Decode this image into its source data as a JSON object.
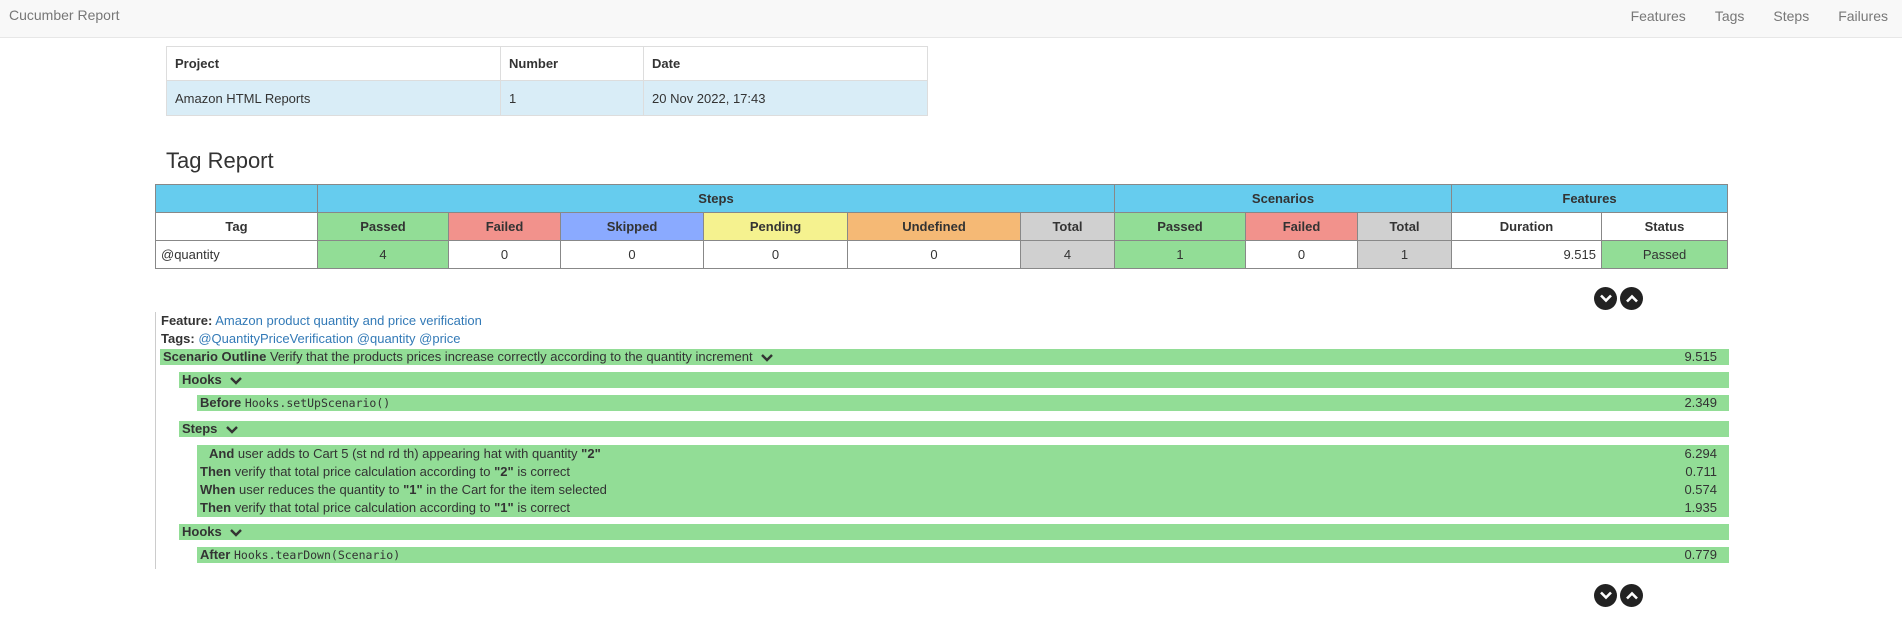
{
  "nav": {
    "brand": "Cucumber Report",
    "items": [
      "Features",
      "Tags",
      "Steps",
      "Failures"
    ]
  },
  "project_info": {
    "headers": [
      "Project",
      "Number",
      "Date"
    ],
    "values": [
      "Amazon HTML Reports",
      "1",
      "20 Nov 2022, 17:43"
    ]
  },
  "report_title": "Tag Report",
  "stats": {
    "group_headers": {
      "steps": "Steps",
      "scenarios": "Scenarios",
      "features": "Features"
    },
    "columns": [
      "Tag",
      "Passed",
      "Failed",
      "Skipped",
      "Pending",
      "Undefined",
      "Total",
      "Passed",
      "Failed",
      "Total",
      "Duration",
      "Status"
    ],
    "row": [
      "@quantity",
      "4",
      "0",
      "0",
      "0",
      "0",
      "4",
      "1",
      "0",
      "1",
      "9.515",
      "Passed"
    ]
  },
  "feature": {
    "feature_label": "Feature:",
    "feature_name": "Amazon product quantity and price verification",
    "tags_label": "Tags:",
    "tags": [
      "@QuantityPriceVerification",
      "@quantity",
      "@price"
    ],
    "scenario_keyword": "Scenario Outline",
    "scenario_name": "Verify that the products prices increase correctly according to the quantity increment",
    "scenario_duration": "9.515",
    "hooks_label": "Hooks",
    "steps_label": "Steps",
    "before_keyword": "Before",
    "before_method": "Hooks.setUpScenario()",
    "before_duration": "2.349",
    "after_keyword": "After",
    "after_method": "Hooks.tearDown(Scenario)",
    "after_duration": "0.779",
    "steps": [
      {
        "keyword": "And",
        "pre": "user adds to Cart 5 (st nd rd th) appearing hat with quantity",
        "arg": "\"2\"",
        "post": "",
        "duration": "6.294"
      },
      {
        "keyword": "Then",
        "pre": "verify that total price calculation according to",
        "arg": "\"2\"",
        "post": "is correct",
        "duration": "0.711"
      },
      {
        "keyword": "When",
        "pre": "user reduces the quantity to",
        "arg": "\"1\"",
        "post": "in the Cart for the item selected",
        "duration": "0.574"
      },
      {
        "keyword": "Then",
        "pre": "verify that total price calculation according to",
        "arg": "\"1\"",
        "post": "is correct",
        "duration": "1.935"
      }
    ]
  },
  "icons": {
    "chevron_down": "chevron-down-icon",
    "chevron_up": "chevron-up-icon"
  },
  "colors": {
    "passed": "#92dd96",
    "failed": "#f2928c",
    "skipped": "#8aaaff",
    "pending": "#f5f28f",
    "undefined": "#f5b975",
    "total": "#d0d0d0",
    "header_blue": "#66ccee",
    "info_row": "#d9edf7",
    "link": "#337ab7"
  }
}
